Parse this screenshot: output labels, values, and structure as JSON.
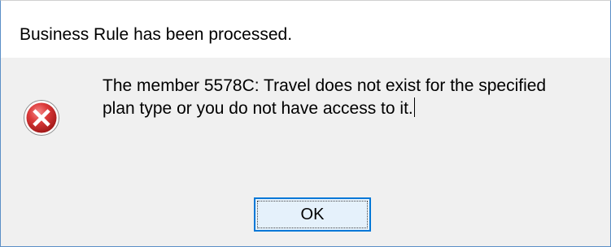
{
  "dialog": {
    "title": "Business Rule has been processed.",
    "icon": "error-icon",
    "message_line1": "The member 5578C: Travel does not exist for the specified",
    "message_line2": "plan type or you do not have access to it.",
    "ok_label": "OK"
  },
  "colors": {
    "error_red": "#d9333f",
    "button_border": "#0078d7",
    "button_fill": "#e5f1fb",
    "content_bg": "#f0f0f0"
  }
}
